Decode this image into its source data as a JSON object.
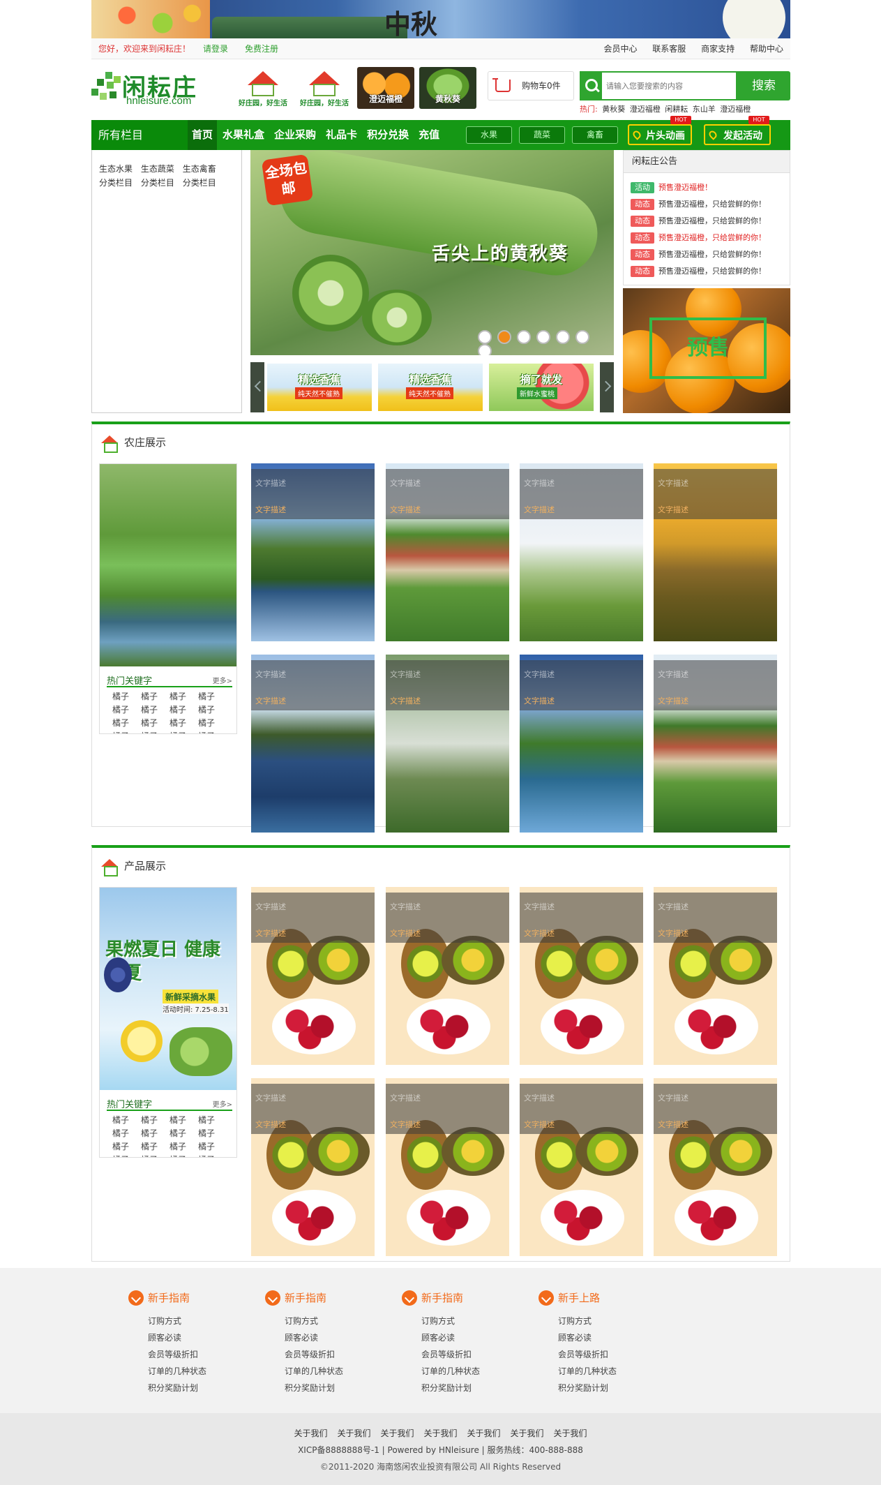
{
  "banner": {
    "title": "中秋"
  },
  "topbar": {
    "welcome": "您好，欢迎来到闲耘庄！",
    "login": "请登录",
    "register": "免费注册",
    "links": [
      "会员中心",
      "联系客服",
      "商家支持",
      "帮助中心"
    ]
  },
  "header": {
    "logo_name": "闲耘庄",
    "logo_url": "hnleisure.com",
    "badges": [
      {
        "text": "好庄园，好生活"
      },
      {
        "text": "好庄园，好生活"
      }
    ],
    "products": [
      {
        "label": "澄迈福橙"
      },
      {
        "label": "黄秋葵"
      }
    ],
    "cart": "购物车0件",
    "search_placeholder": "请输入您要搜索的内容",
    "search_button": "搜索",
    "hot_label": "热门:",
    "hot_items": [
      "黄秋葵",
      "澄迈福橙",
      "闲耕耘",
      "东山羊",
      "澄迈福橙"
    ]
  },
  "nav": {
    "all_label": "所有栏目",
    "items": [
      "首页",
      "水果礼盒",
      "企业采购",
      "礼品卡",
      "积分兑换",
      "充值"
    ],
    "pills": [
      "水果",
      "蔬菜",
      "禽畜"
    ],
    "actions": [
      "片头动画",
      "发起活动"
    ],
    "hot": "HOT"
  },
  "categories": {
    "row1": [
      "生态水果",
      "生态蔬菜",
      "生态禽畜"
    ],
    "row2": [
      "分类栏目",
      "分类栏目",
      "分类栏目"
    ]
  },
  "slider": {
    "badge": "全场包邮",
    "caption": "舌尖上的黄秋葵",
    "active_dot": 1,
    "dot_count": 7
  },
  "thumbs": [
    {
      "title": "精选香蕉",
      "sub": "纯天然不催熟"
    },
    {
      "title": "精选香蕉",
      "sub": "纯天然不催熟"
    },
    {
      "title": "摘了就发",
      "sub": "新鲜水蜜桃"
    }
  ],
  "notice": {
    "title": "闲耘庄公告",
    "items": [
      {
        "tag": "活动",
        "text": "预售澄迈福橙！",
        "hl": true
      },
      {
        "tag": "动态",
        "text": "预售澄迈福橙，只给尝鲜的你！",
        "hl": false
      },
      {
        "tag": "动态",
        "text": "预售澄迈福橙，只给尝鲜的你！",
        "hl": false
      },
      {
        "tag": "动态",
        "text": "预售澄迈福橙，只给尝鲜的你！",
        "hl": true
      },
      {
        "tag": "动态",
        "text": "预售澄迈福橙，只给尝鲜的你！",
        "hl": false
      },
      {
        "tag": "动态",
        "text": "预售澄迈福橙，只给尝鲜的你！",
        "hl": false
      }
    ],
    "presale": "预售"
  },
  "farm": {
    "title": "农庄展示",
    "caption1": "文字描述",
    "caption2": "文字描述",
    "kw_title": "热门关键字",
    "kw_more": "更多>",
    "keywords": [
      "橘子",
      "橘子",
      "橘子",
      "橘子",
      "橘子",
      "橘子",
      "橘子",
      "橘子",
      "橘子",
      "橘子",
      "橘子",
      "橘子",
      "橘子",
      "橘子",
      "橘子",
      "橘子"
    ]
  },
  "products": {
    "title": "产品展示",
    "caption1": "文字描述",
    "caption2": "文字描述",
    "feat_text": "果燃夏日 健康一夏",
    "feat_sub": "新鲜采摘水果",
    "feat_date": "活动时间: 7.25-8.31",
    "kw_title": "热门关键字",
    "kw_more": "更多>",
    "keywords": [
      "橘子",
      "橘子",
      "橘子",
      "橘子",
      "橘子",
      "橘子",
      "橘子",
      "橘子",
      "橘子",
      "橘子",
      "橘子",
      "橘子",
      "橘子",
      "橘子",
      "橘子",
      "橘子"
    ]
  },
  "footer": {
    "columns": [
      {
        "title": "新手指南",
        "links": [
          "订购方式",
          "顾客必读",
          "会员等级折扣",
          "订单的几种状态",
          "积分奖励计划"
        ]
      },
      {
        "title": "新手指南",
        "links": [
          "订购方式",
          "顾客必读",
          "会员等级折扣",
          "订单的几种状态",
          "积分奖励计划"
        ]
      },
      {
        "title": "新手指南",
        "links": [
          "订购方式",
          "顾客必读",
          "会员等级折扣",
          "订单的几种状态",
          "积分奖励计划"
        ]
      },
      {
        "title": "新手上路",
        "links": [
          "订购方式",
          "顾客必读",
          "会员等级折扣",
          "订单的几种状态",
          "积分奖励计划"
        ]
      }
    ],
    "bottom_links": [
      "关于我们",
      "关于我们",
      "关于我们",
      "关于我们",
      "关于我们",
      "关于我们",
      "关于我们"
    ],
    "icp": "XICP备8888888号-1 | Powered by HNleisure | 服务热线：400-888-888",
    "copyright": "©2011-2020 海南悠闲农业投资有限公司 All Rights Reserved"
  },
  "colors": {
    "brand_green": "#159815",
    "accent_orange": "#f26a1a",
    "notice_red": "#ef5a5a"
  }
}
